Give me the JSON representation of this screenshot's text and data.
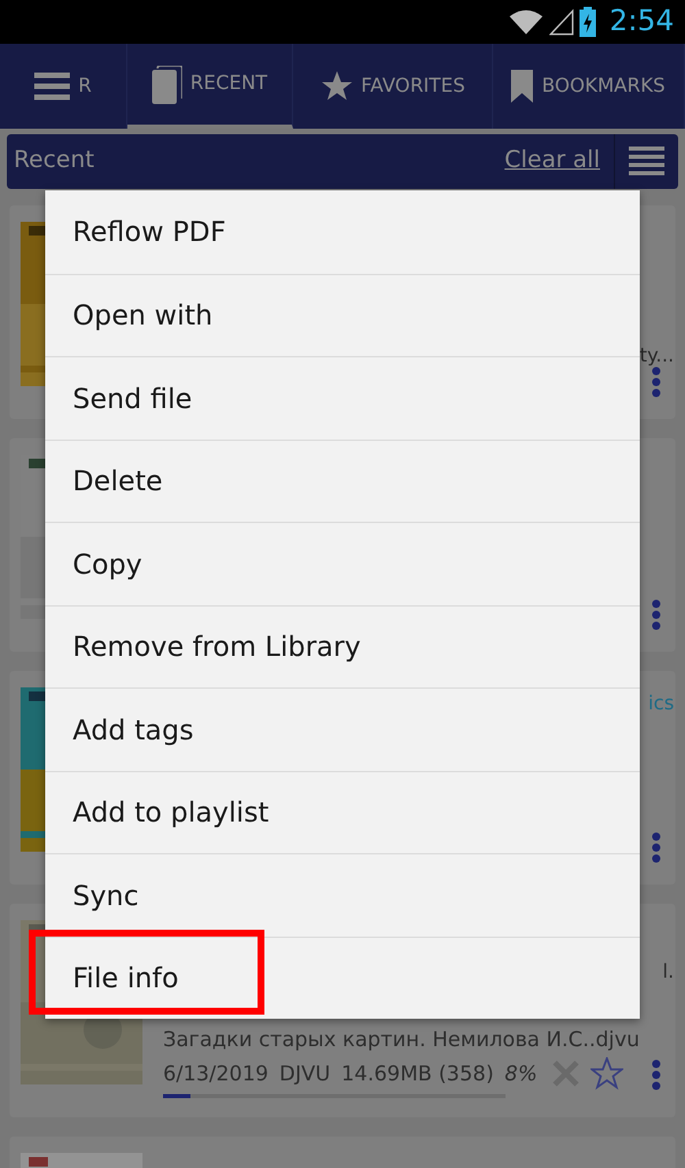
{
  "status_bar": {
    "time": "2:54"
  },
  "tabs": [
    {
      "label": "R",
      "kind": "menu",
      "selected": false
    },
    {
      "label": "RECENT",
      "kind": "recent",
      "selected": true
    },
    {
      "label": "FAVORITES",
      "kind": "favorites",
      "selected": false
    },
    {
      "label": "BOOKMARKS",
      "kind": "bookmarks",
      "selected": false
    }
  ],
  "header": {
    "title": "Recent",
    "clear_link": "Clear all"
  },
  "books": [
    {
      "kind": "picture",
      "title": "ty..."
    },
    {
      "kind": "picture"
    },
    {
      "kind": "picture",
      "tag": "ics"
    },
    {
      "kind": "picture",
      "title": "l.",
      "file": "Загадки старых картин. Немилова И.С..djvu",
      "date": "6/13/2019",
      "format": "DJVU",
      "size": "14.69MB (358)",
      "percent": "8%",
      "level": 0.08
    },
    {
      "kind": "picture"
    }
  ],
  "context_menu": {
    "items": [
      {
        "label": "Reflow PDF",
        "highlighted": false
      },
      {
        "label": "Open with",
        "highlighted": false
      },
      {
        "label": "Send file",
        "highlighted": false
      },
      {
        "label": "Delete",
        "highlighted": false
      },
      {
        "label": "Copy",
        "highlighted": false
      },
      {
        "label": "Remove from Library",
        "highlighted": false
      },
      {
        "label": "Add tags",
        "highlighted": false
      },
      {
        "label": "Add to playlist",
        "highlighted": false
      },
      {
        "label": "Sync",
        "highlighted": false
      },
      {
        "label": "File info",
        "highlighted": true
      }
    ]
  }
}
